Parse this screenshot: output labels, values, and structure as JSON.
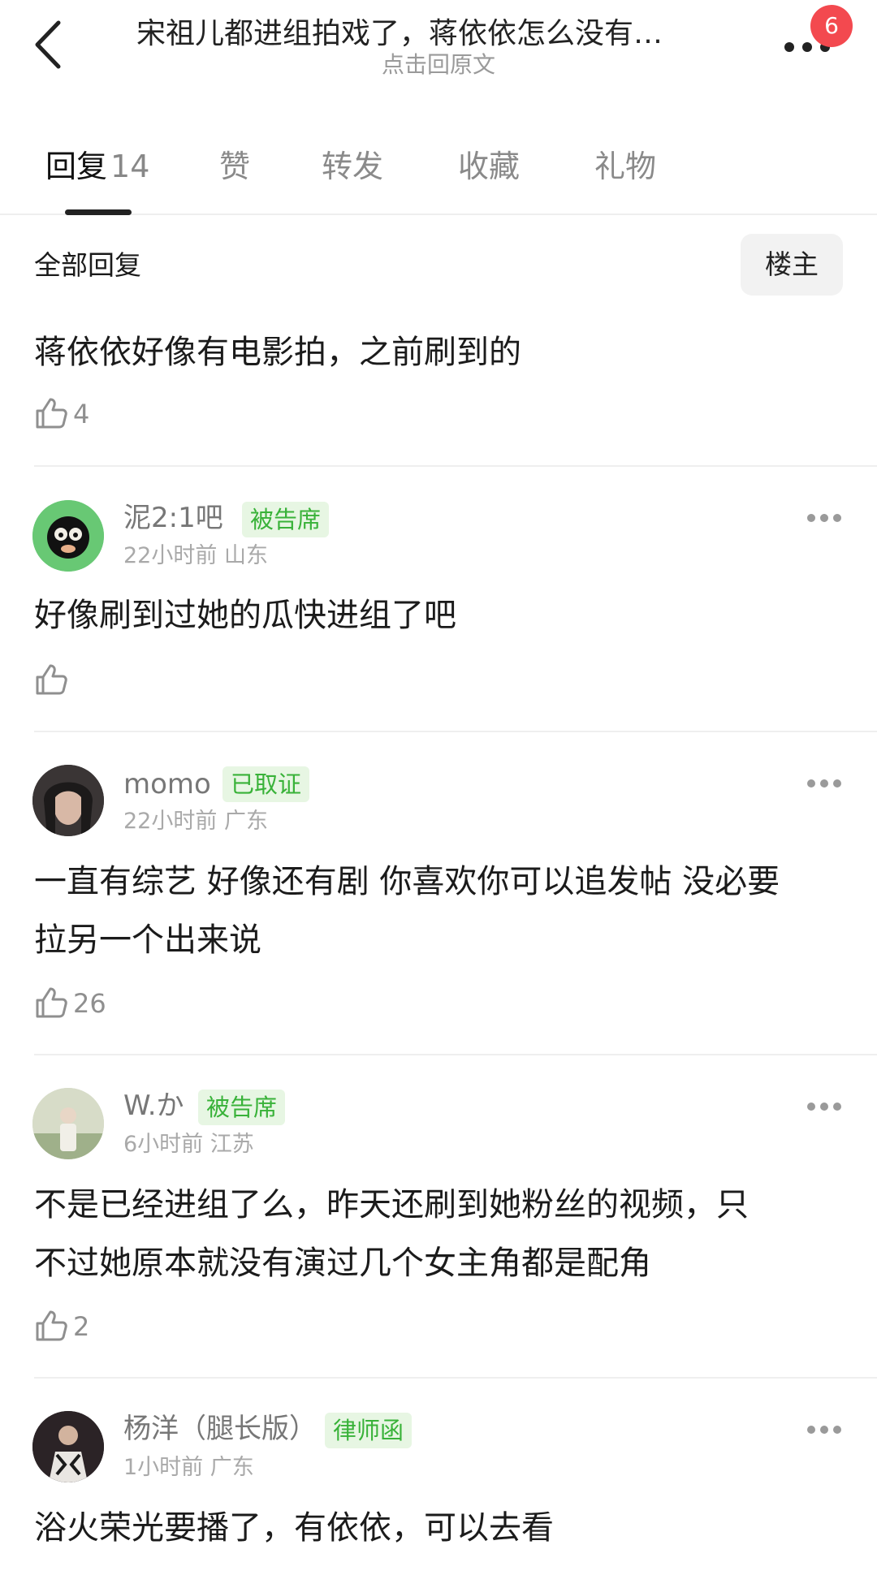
{
  "header": {
    "title": "宋祖儿都进组拍戏了，蒋依依怎么没有…",
    "subtitle": "点击回原文",
    "notification_count": "6"
  },
  "tabs": [
    {
      "label": "回复",
      "count": "14"
    },
    {
      "label": "赞"
    },
    {
      "label": "转发"
    },
    {
      "label": "收藏"
    },
    {
      "label": "礼物"
    }
  ],
  "section": {
    "title": "全部回复",
    "op_filter": "楼主"
  },
  "first_reply": {
    "text": "蒋依依好像有电影拍，之前刷到的",
    "likes": "4"
  },
  "comments": [
    {
      "username": "泥2:1吧",
      "tag": "被告席",
      "time": "22小时前",
      "location": "山东",
      "text": "好像刷到过她的瓜快进组了吧",
      "likes": ""
    },
    {
      "username": "momo",
      "tag": "已取证",
      "time": "22小时前",
      "location": "广东",
      "text_lines": [
        "一直有综艺 好像还有剧 你喜欢你可以追发帖 没必要",
        "拉另一个出来说"
      ],
      "likes": "26"
    },
    {
      "username": "W.か",
      "tag": "被告席",
      "time": "6小时前",
      "location": "江苏",
      "text_lines": [
        "不是已经进组了么，昨天还刷到她粉丝的视频，只",
        "不过她原本就没有演过几个女主角都是配角"
      ],
      "likes": "2"
    },
    {
      "username": "杨洋（腿长版）",
      "tag": "律师函",
      "time": "1小时前",
      "location": "广东",
      "text": "浴火荣光要播了，有依依，可以去看"
    }
  ],
  "colors": {
    "tag_bg": "#e7f6e3",
    "tag_text": "#39b239",
    "badge": "#f3494f"
  }
}
